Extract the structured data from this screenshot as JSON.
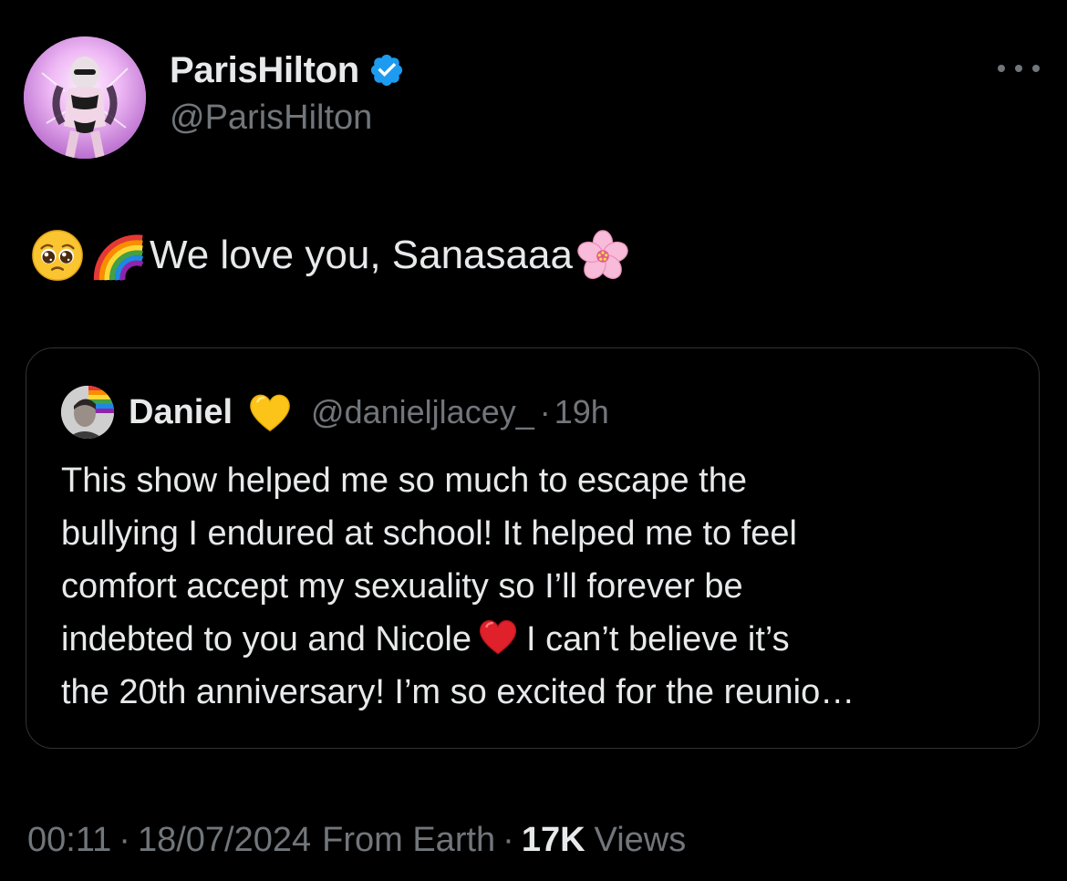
{
  "author": {
    "display_name": "ParisHilton",
    "handle": "@ParisHilton",
    "verified": true
  },
  "tweet": {
    "text": "We love you, Sanasaaa",
    "emojis_before": [
      "pleading-face-emoji",
      "rainbow-emoji"
    ],
    "emojis_after": [
      "cherry-blossom-emoji"
    ]
  },
  "quoted": {
    "display_name": "Daniel",
    "handle": "@danieljlacey_",
    "separator": "·",
    "time": "19h",
    "lines": [
      "This show helped me so much to escape the",
      "bullying I endured at school! It helped me to feel",
      "comfort accept my sexuality so I’ll forever be",
      "indebted to you and Nicole",
      "I can’t believe it’s",
      "the 20th anniversary! I’m so excited for the reunio…"
    ]
  },
  "meta": {
    "time": "00:11",
    "sep1": "·",
    "date": "18/07/2024",
    "source": "From Earth",
    "sep2": "·",
    "views_count": "17K",
    "views_label": "Views"
  },
  "colors": {
    "background": "#000000",
    "text": "#e7e9ea",
    "secondary": "#71767b",
    "verified": "#1d9bf0",
    "border": "#2f3336"
  }
}
